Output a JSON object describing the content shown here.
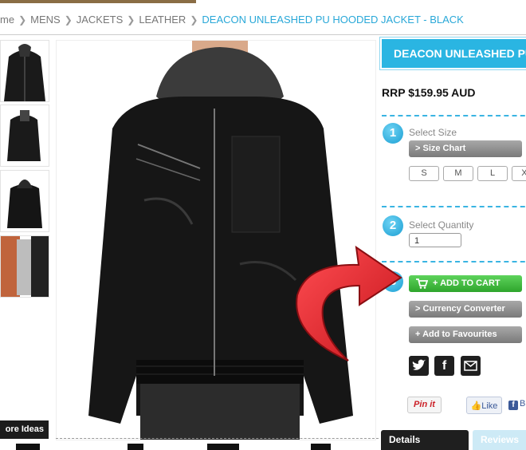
{
  "breadcrumb": {
    "home": "me",
    "items": [
      "MENS",
      "JACKETS",
      "LEATHER"
    ],
    "current": "DEACON UNLEASHED PU HOODED JACKET - BLACK"
  },
  "product": {
    "title": "DEACON UNLEASHED PU",
    "price": "RRP $159.95 AUD"
  },
  "steps": {
    "size": {
      "number": "1",
      "label": "Select Size",
      "size_chart": "> Size Chart",
      "sizes": [
        "S",
        "M",
        "L",
        "XL"
      ]
    },
    "quantity": {
      "number": "2",
      "label": "Select Quantity",
      "value": "1"
    },
    "add": {
      "number": "3"
    }
  },
  "buttons": {
    "add_to_cart": "+ ADD TO CART",
    "currency": "> Currency Converter",
    "favourites": "+ Add to Favourites"
  },
  "social": {
    "pinit": "Pin it",
    "like": "Like",
    "fb_extra": "B",
    "icons": [
      "twitter-icon",
      "facebook-icon",
      "email-icon"
    ]
  },
  "gallery": {
    "more_ideas": "ore Ideas"
  },
  "tabs": {
    "details": "Details",
    "reviews": "Reviews"
  },
  "colors": {
    "accent": "#2ab5e2",
    "cart": "#3cb83a",
    "arrow": "#e5232a"
  }
}
